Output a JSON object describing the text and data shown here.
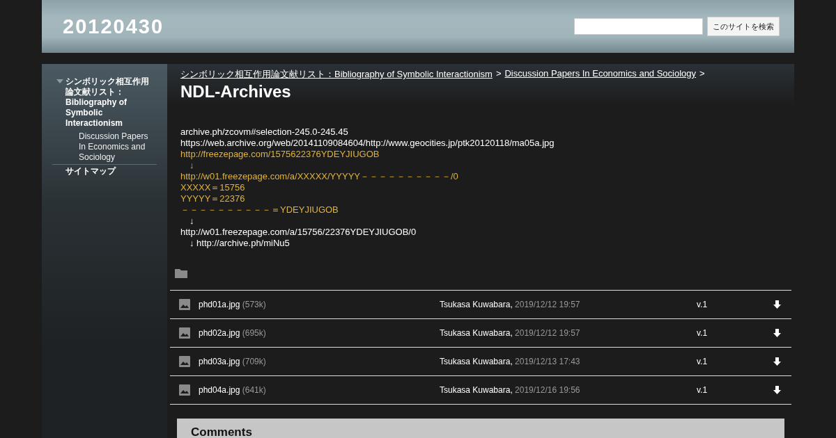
{
  "header": {
    "site_title": "20120430",
    "search": {
      "button": "このサイトを検索"
    }
  },
  "sidebar": {
    "items": [
      {
        "label": "シンボリック相互作用論文献リスト：Bibliography of Symbolic Interactionism",
        "expanded": true,
        "children": [
          {
            "label": "Discussion Papers In Economics and Sociology"
          }
        ]
      },
      {
        "label": "サイトマップ"
      }
    ]
  },
  "breadcrumb": [
    {
      "label": "シンボリック相互作用論文献リスト：Bibliography of Symbolic Interactionism"
    },
    {
      "label": "Discussion Papers In Economics and Sociology"
    }
  ],
  "breadcrumb_separator": ">",
  "page_title": "NDL-Archives",
  "content_lines": [
    {
      "kind": "plain",
      "text": "archive.ph/zcovm#selection-245.0-245.45"
    },
    {
      "kind": "plain",
      "text": "https://web.archive.org/web/20141109084604/http://www.geocities.jp/ptk20120118/ma05a.jpg"
    },
    {
      "kind": "accent",
      "text": "http://freezepage.com/1575622376YDEYJIUGOB"
    },
    {
      "kind": "accent",
      "text": "　↓"
    },
    {
      "kind": "accent",
      "text": "http://w01.freezepage.com/a/XXXXX/YYYYY－－－－－－－－－－/0"
    },
    {
      "kind": "accent",
      "text": "XXXXX＝15756"
    },
    {
      "kind": "accent",
      "text": "YYYYY＝22376"
    },
    {
      "kind": "accent",
      "text": "－－－－－－－－－－＝YDEYJIUGOB"
    },
    {
      "kind": "plain",
      "text": "　↓"
    },
    {
      "kind": "plain",
      "text": "http://w01.freezepage.com/a/15756/22376YDEYJIUGOB/0"
    },
    {
      "kind": "plain",
      "text": "　↓ http://archive.ph/miNu5"
    }
  ],
  "files": [
    {
      "name": "phd01a.jpg",
      "size": "(573k)",
      "author": "Tsukasa Kuwabara,",
      "date": "2019/12/12 19:57",
      "version": "v.1"
    },
    {
      "name": "phd02a.jpg",
      "size": "(695k)",
      "author": "Tsukasa Kuwabara,",
      "date": "2019/12/12 19:57",
      "version": "v.1"
    },
    {
      "name": "phd03a.jpg",
      "size": "(709k)",
      "author": "Tsukasa Kuwabara,",
      "date": "2019/12/13 17:43",
      "version": "v.1"
    },
    {
      "name": "phd04a.jpg",
      "size": "(641k)",
      "author": "Tsukasa Kuwabara,",
      "date": "2019/12/16 19:56",
      "version": "v.1"
    }
  ],
  "comments": {
    "title": "Comments"
  }
}
